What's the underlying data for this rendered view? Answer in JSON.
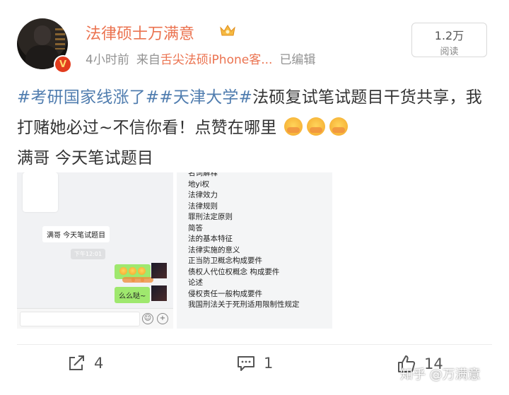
{
  "user": {
    "name": "法律硕士万满意",
    "time": "4小时前",
    "source_prefix": "来自",
    "source": "舌尖法硕iPhone客...",
    "edited": "已编辑",
    "badge": "V"
  },
  "reads": {
    "count": "1.2万",
    "label": "阅读"
  },
  "post": {
    "topic1": "#考研国家线涨了#",
    "topic2": "#天津大学#",
    "text1": "法硕复试笔试题目干货共享，我打赌她必过~不信你看！点赞在哪里",
    "text2": "满哥 今天笔试题目"
  },
  "image1": {
    "bubble": "满哥 今天笔试题目",
    "time": "下午12:01",
    "reply": "么么哒~",
    "emoji_icon": "smile-emoji-icon"
  },
  "image2": {
    "lines": [
      "名词解释",
      "地yi权",
      "法律效力",
      "法律规则",
      "罪刑法定原则",
      "简答",
      "法的基本特征",
      "法律实施的意义",
      "正当防卫概念构成要件",
      "债权人代位权概念 构成要件",
      "论述",
      "侵权责任一般构成要件",
      "我国刑法关于死刑适用限制性规定"
    ]
  },
  "actions": {
    "share_count": "4",
    "comment_count": "1",
    "like_count": "14",
    "share_icon": "share-icon",
    "comment_icon": "comment-icon",
    "like_icon": "thumbs-up-icon"
  },
  "watermark": "知乎 @万满意",
  "colors": {
    "username": "#eb7350",
    "topic": "#507daf",
    "meta": "#939393",
    "chat_green": "#9fe86e"
  }
}
